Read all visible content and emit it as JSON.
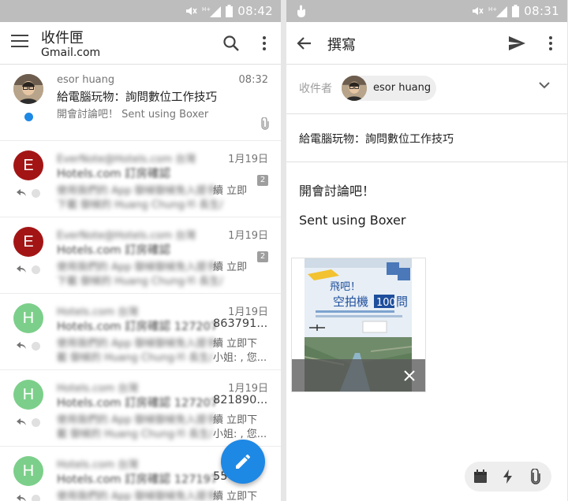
{
  "inbox": {
    "status": {
      "time": "08:42"
    },
    "title": "收件匣",
    "account": "Gmail.com",
    "icons": {
      "menu": "hamburger-menu-icon",
      "search": "search-icon",
      "more": "more-vertical-icon",
      "compose": "pencil-icon"
    },
    "emails": [
      {
        "sender": "esor huang",
        "date": "08:32",
        "subject": "給電腦玩物：詢問數位工作技巧",
        "snippet": "開會討論吧！ Sent using Boxer",
        "unread": true,
        "attachment": true
      },
      {
        "avatar": "E",
        "avatar_color": "#a31515",
        "sender": "EverNote@Hotels.com 台灣",
        "date": "1月19日",
        "subject": "Hotels.com 訂房確認",
        "snippet_blur": "使用我們的 App 御候御候免入提手",
        "snippet_clear": "續 立即",
        "snippet2_blur": "下載 御候的 Huang Chung-Yi 長生/",
        "snippet2_clear": "",
        "count": "2"
      },
      {
        "avatar": "E",
        "avatar_color": "#a31515",
        "sender": "EverNote@Hotels.com 台灣",
        "date": "1月19日",
        "subject": "Hotels.com 訂房確認",
        "snippet_blur": "使用我們的 App 御候御候免入提手",
        "snippet_clear": "續 立即",
        "snippet2_blur": "下載 御候的 Huang Chung-Yi 長生/",
        "snippet2_clear": "",
        "count": "2"
      },
      {
        "avatar": "H",
        "avatar_color": "#7ccf8a",
        "sender": "Hotels.com 台灣",
        "date": "1月19日",
        "subject_blur": "Hotels.com 訂房確認 127207",
        "subject_clear": "863791...",
        "snippet_blur": "使用我們的 App 御候御候免入提手",
        "snippet_clear": "續 立即下",
        "snippet2_blur": "載 御候的 Huang Chung-Yi 長生/",
        "snippet2_clear": "小姐: , 您..."
      },
      {
        "avatar": "H",
        "avatar_color": "#7ccf8a",
        "sender": "Hotels.com 台灣",
        "date": "1月19日",
        "subject_blur": "Hotels.com 訂房確認 127207",
        "subject_clear": "821890...",
        "snippet_blur": "使用我們的 App 御候御候免入提手",
        "snippet_clear": "續 立即下",
        "snippet2_blur": "載 御候的 Huang Chung-Yi 長生/",
        "snippet2_clear": "小姐: , 您..."
      },
      {
        "avatar": "H",
        "avatar_color": "#7ccf8a",
        "sender": "Hotels.com 台灣",
        "date": "",
        "subject_blur": "Hotels.com 訂房確認 127197",
        "subject_clear": "55",
        "snippet_blur": "使用我們的 App 御候御候免入提手",
        "snippet_clear": "續 立即下",
        "snippet2_blur": "",
        "snippet2_clear": ""
      }
    ]
  },
  "compose": {
    "status": {
      "time": "08:31"
    },
    "title": "撰寫",
    "icons": {
      "back": "back-arrow-icon",
      "send": "send-icon",
      "more": "more-vertical-icon",
      "expand": "chevron-down-icon",
      "calendar": "calendar-icon",
      "quick_reply": "lightning-icon",
      "attach": "paperclip-icon",
      "remove_attachment": "close-icon"
    },
    "to_label": "收件者",
    "recipient": "esor huang",
    "subject": "給電腦玩物：詢問數位工作技巧",
    "body": [
      "開會討論吧！",
      "Sent using Boxer"
    ],
    "attachment": {
      "line1": "飛吧！",
      "line2": "空拍機",
      "line3": "100",
      "line4": "問"
    }
  }
}
